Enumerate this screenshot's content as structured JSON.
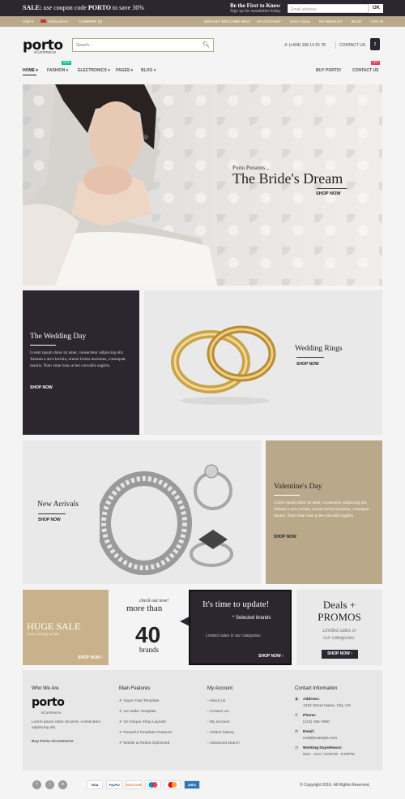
{
  "topbar": {
    "sale_prefix": "SALE:",
    "sale_text": " use coupon code ",
    "sale_code": "PORTO",
    "sale_suffix": " to save 30%",
    "first_to_know": "Be the First to Know",
    "signup": "Sign up for newsletter today.",
    "email_placeholder": "Email address",
    "ok_label": "OK"
  },
  "linkbar": {
    "currency": "USD ▾",
    "language": "ENGLISH ▾",
    "compare": "COMPARE (2)",
    "welcome": "DEFAULT WELCOME MSG!",
    "links": [
      "MY ACCOUNT",
      "DAILY DEAL",
      "MY WISHLIST",
      "BLOG",
      "LOG IN"
    ]
  },
  "header": {
    "logo": "porto",
    "logo_sub": "eCommerce",
    "search_placeholder": "Search...",
    "phone": "(+404) 158 14 25 78",
    "contact": "CONTACT US",
    "cart_count": "2"
  },
  "nav": {
    "items": [
      "HOME ▾",
      "FASHION ▾",
      "ELECTRONICS ▾",
      "PAGES ▾",
      "BLOG ▾"
    ],
    "right": [
      "BUY PORTO!",
      "CONTACT US"
    ],
    "badges": {
      "new": "NEW",
      "hot": "HOT"
    }
  },
  "hero": {
    "presents": "Porto Presents...",
    "title": "The Bride's Dream",
    "shop": "SHOP NOW"
  },
  "panels": {
    "wedding_day": {
      "title": "The Wedding Day",
      "text": "Lorem ipsum dolor sit amet, consectetur adipiscing elit. Aenean a arcu lacinia, ornare lorem maximus, consequat mauris. Nam vitae risus at leo convallis sagittis.",
      "shop": "SHOP NOW"
    },
    "wedding_rings": {
      "title": "Wedding Rings",
      "shop": "SHOP NOW"
    },
    "new_arrivals": {
      "title": "New Arrivals",
      "shop": "SHOP NOW"
    },
    "valentines": {
      "title": "Valentine's Day",
      "text": "Lorem ipsum dolor sit amet, consectetur adipiscing elit. Aenean a arcu lacinia, ornare lorem maximus, consequat mauris. Nam vitae risus at leo convallis sagittis.",
      "shop": "SHOP NOW"
    }
  },
  "promos": {
    "huge_sale": {
      "title": "HUGE SALE",
      "sub": "Now starting at $99",
      "shop": "SHOP NOW ›"
    },
    "brands": {
      "checkout": "check out now!",
      "more_than": "more than",
      "number": "40",
      "brands": "brands"
    },
    "update": {
      "title": "It's time to update!",
      "selected": "* Selected brands",
      "limited": "Limited sales in our categories.",
      "shop": "SHOP NOW ›"
    },
    "deals": {
      "title": "Deals +",
      "title2": "PROMOS",
      "limited": "Limited sales in",
      "limited2": "our categories.",
      "shop": "SHOP NOW ›"
    }
  },
  "footer": {
    "who": {
      "heading": "Who We Are",
      "logo": "porto",
      "logo_sub": "eCommerce",
      "text": "Lorem ipsum dolor sit amet, consectetur adipiscing elit.",
      "link": "Buy Porto eCommerce"
    },
    "features": {
      "heading": "Main Features",
      "items": [
        "Super Fast Template",
        "1st Seller Template",
        "19 Unique Shop Layouts",
        "Powerful Template Features",
        "Mobile & Retina Optimized"
      ]
    },
    "account": {
      "heading": "My Account",
      "items": [
        "About Us",
        "Contact Us",
        "My account",
        "Orders history",
        "Advanced search"
      ]
    },
    "contact": {
      "heading": "Contact Information",
      "address_label": "Address:",
      "address": "1234 Street Name, City, US",
      "phone_label": "Phone:",
      "phone": "(123) 456-7890",
      "email_label": "Email:",
      "email": "mail@example.com",
      "hours_label": "Working Days/Hours:",
      "hours": "Mon - Sun / 9:00AM - 8:00PM"
    },
    "payments": [
      "VISA",
      "PayPal",
      "DISCOVER",
      "",
      "",
      "AMEX"
    ],
    "copyright": "© Copyright 2016. All Rights Reserved."
  },
  "colors": {
    "dark": "#2b2630",
    "tan": "#b9a98a",
    "grey": "#e9e9e9",
    "new_badge": "#0cc485",
    "hot_badge": "#e63c5a"
  }
}
